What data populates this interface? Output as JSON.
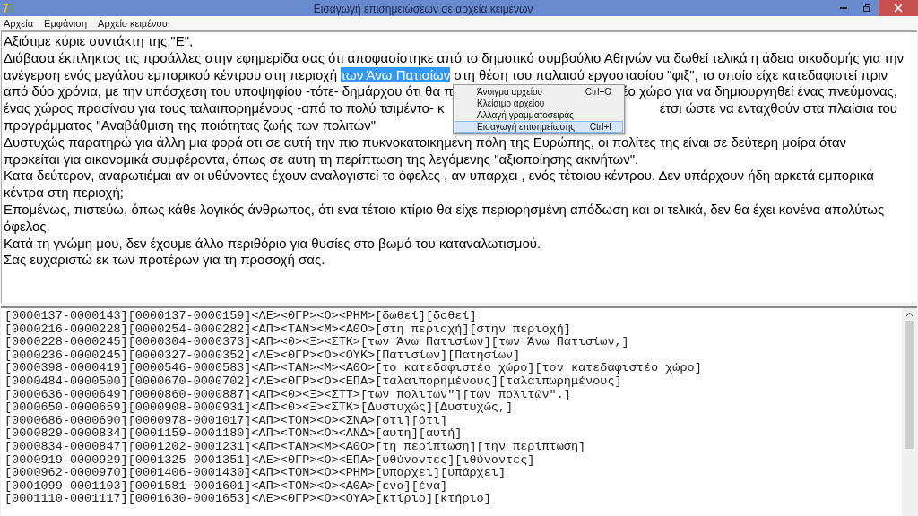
{
  "window": {
    "title": "Εισαγωγή επισημειώσεων σε αρχεία κειμένων"
  },
  "menu": [
    "Αρχεία",
    "Εμφάνιση",
    "Αρχείο κειμένου"
  ],
  "editor": {
    "lines": [
      {
        "segments": [
          {
            "text": "Αξιότιμε κύριε συντάκτη της \"Ε\",",
            "selected": false
          }
        ]
      },
      {
        "segments": [
          {
            "text": "Διάβασα έκπληκτος τις προάλλες στην εφημερίδα σας ότι αποφασίστηκε από το δημοτικό συμβούλιο Αθηνών να δωθεί τελικά η άδεια οικοδομής για την",
            "selected": false
          }
        ]
      },
      {
        "segments": [
          {
            "text": "ανέγερση ενός μεγάλου εμπορικού κέντρου στη περιοχή ",
            "selected": false
          },
          {
            "text": "των Άνω Πατισίων",
            "selected": true
          },
          {
            "text": " στη θέση του παλαιού εργοστασίου \"φιξ\", το οποίο είχε κατεδαφιστεί πριν",
            "selected": false
          }
        ]
      },
      {
        "segments": [
          {
            "text": "από δύο χρόνια, με την υπόσχεση του υποψηφίου -τότε- δημάρχου ότι θα π",
            "selected": false
          }
        ],
        "right": [
          {
            "text": "έο χώρο για να δημιουργηθεί ένας πνεύμονας,",
            "selected": false
          }
        ]
      },
      {
        "segments": [
          {
            "text": "ένας χώρος πρασίνου για τους ταλαιπορημένους -από το πολύ τσιμέντο- κ",
            "selected": false
          }
        ],
        "right": [
          {
            "text": "έτσι ώστε να ενταχθούν στα πλαίσια του",
            "selected": false
          }
        ]
      },
      {
        "segments": [
          {
            "text": "προγράμματος \"Αναβάθμιση της ποιότητας ζωής των πολιτών\"",
            "selected": false
          }
        ]
      },
      {
        "segments": [
          {
            "text": "Δυστυχώς παρατηρώ για άλλη μια φορά οτι σε αυτή την πιο πυκνοκατοικημένη πόλη της Ευρώπης, οι πολίτες της είναι σε δεύτερη μοίρα όταν",
            "selected": false
          }
        ]
      },
      {
        "segments": [
          {
            "text": "προκείται για οικονομικά συμφέροντα, όπως σε αυτη τη περίπτωση της λεγόμενης \"αξιοποίησης ακινήτων\".",
            "selected": false
          }
        ]
      },
      {
        "segments": [
          {
            "text": "Κατα δεύτερον, αναρωτιέμαι αν οι υθύνοντες έχουν αναλογιστεί το όφελες , αν υπαρχει , ενός τέτοιου κέντρου. Δεν υπάρχουν ήδη αρκετά εμπορικά",
            "selected": false
          }
        ]
      },
      {
        "segments": [
          {
            "text": "κέντρα στη περιοχή;",
            "selected": false
          }
        ]
      },
      {
        "segments": [
          {
            "text": "Επομένως, πιστεύω, όπως κάθε λογικός άνθρωπος, ότι ενα τέτοιο κτίριο θα είχε περιορησμένη απόδωση και οι τελικά, δεν θα έχει κανένα απολύτως",
            "selected": false
          }
        ]
      },
      {
        "segments": [
          {
            "text": "όφελος.",
            "selected": false
          }
        ]
      },
      {
        "segments": [
          {
            "text": "Κατά τη γνώμη μου, δεν έχουμε άλλο περιθόριο για θυσίες στο βωμό του καταναλωτισμού.",
            "selected": false
          }
        ]
      },
      {
        "segments": [
          {
            "text": "Σας ευχαριστώ εκ των προτέρων για τη προσοχή σας.",
            "selected": false
          }
        ]
      }
    ]
  },
  "context_menu": [
    {
      "label": "Άνοιγμα αρχείου",
      "shortcut": "Ctrl+O",
      "selected": false
    },
    {
      "label": "Κλείσιμο αρχείου",
      "selected": false
    },
    {
      "label": "Αλλαγή γραμματοσειράς",
      "selected": false
    },
    {
      "label": "Εισαγωγή επισημείωσης",
      "shortcut": "Ctrl+I",
      "selected": true
    }
  ],
  "annotations": [
    "[0000137-0000143][0000137-0000159]<ΛΕ><ΘΓΡ><Ο><ΡΗΜ>[δωθεί][δοθεί]",
    "[0000216-0000228][0000254-0000282]<ΑΠ><ΤΑΝ><Μ><ΑΘΟ>[στη περιοχή][στην περιοχή]",
    "[0000228-0000245][0000304-0000373]<ΑΠ><0><Ξ><ΣΤΚ>[των Άνω Πατισίων][των Άνω Πατισίων,]",
    "[0000236-0000245][0000327-0000352]<ΛΕ><ΘΓΡ><Ο><ΟΥΚ>[Πατισίων][Πατησίων]",
    "[0000398-0000419][0000546-0000583]<ΑΠ><ΤΑΝ><Μ><ΑΘΟ>[το κατεδαφιστέο χώρο][τον κατεδαφιστέο χώρο]",
    "[0000484-0000500][0000670-0000702]<ΛΕ><ΘΓΡ><Ο><ΕΠΑ>[ταλαιπορημένους][ταλαιπωρημένους]",
    "[0000636-0000649][0000860-0000887]<ΑΠ><0><Ξ><ΣΤΤ>[των πολιτών\"][των πολιτών\".]",
    "[0000650-0000659][0000908-0000931]<ΑΠ><0><Ξ><ΣΤΚ>[Δυστυχώς][Δυστυχώς,]",
    "[0000686-0000690][0000978-0001017]<ΑΠ><ΤΟΝ><Ο><ΣΝΑ>[οτι][ότι]",
    "[0000829-0000834][0001159-0001180]<ΑΠ><ΤΟΝ><Ο><ΑΝΔ>[αυτη][αυτή]",
    "[0000834-0000847][0001202-0001231]<ΑΠ><ΤΑΝ><Μ><ΑΘΟ>[τη περίπτωση][την περίπτωση]",
    "[0000919-0000929][0001325-0001351]<ΛΕ><ΘΓΡ><Ο><ΕΠΑ>[υθύνοντες][ιθύνοντες]",
    "[0000962-0000970][0001406-0001430]<ΑΠ><ΤΟΝ><Ο><ΡΗΜ>[υπαρχει][υπάρχει]",
    "[0001099-0001103][0001581-0001601]<ΑΠ><ΤΟΝ><Ο><ΑΘΑ>[ενα][ένα]",
    "[0001110-0001117][0001630-0001653]<ΛΕ><ΘΓΡ><Ο><ΟΥΑ>[κτίριο][κτήριο]"
  ]
}
